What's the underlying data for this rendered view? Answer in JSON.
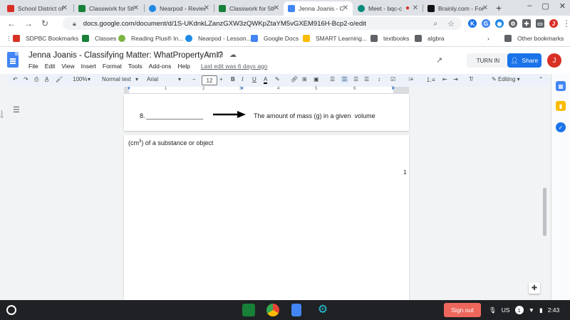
{
  "browser": {
    "tabs": [
      {
        "label": "School District of",
        "favicon_color": "#d93025"
      },
      {
        "label": "Classwork for 5th",
        "favicon_color": "#188038"
      },
      {
        "label": "Nearpod - Review",
        "favicon_color": "#1e88e5"
      },
      {
        "label": "Classwork for 5th",
        "favicon_color": "#188038"
      },
      {
        "label": "Jenna Joanis - Cl",
        "favicon_color": "#4285f4"
      },
      {
        "label": "Meet - bqc-c",
        "favicon_color": "#00897b"
      },
      {
        "label": "Brainly.com - For",
        "favicon_color": "#111111"
      }
    ],
    "active_tab_index": 4,
    "url": "docs.google.com/document/d/1S-UKdnkLZanzGXW3zQWKpZtaYM5vGXEM916H-Bcp2-o/edit",
    "bookmarks": [
      "SDPBC Bookmarks",
      "Classes",
      "Reading Plus® In...",
      "Nearpod - Lesson...",
      "Google Docs",
      "SMART Learning...",
      "textbooks",
      "algbra"
    ],
    "other_bookmarks": "Other bookmarks"
  },
  "doc": {
    "title": "Jenna Joanis - Classifying Matter: WhatPropertyAmI?",
    "menus": [
      "File",
      "Edit",
      "View",
      "Insert",
      "Format",
      "Tools",
      "Add-ons",
      "Help"
    ],
    "last_edit": "Last edit was 6 days ago",
    "turn_in": "TURN IN",
    "share": "Share",
    "account_initial": "J"
  },
  "toolbar": {
    "zoom": "100%",
    "style": "Normal text",
    "font": "Arial",
    "font_size": "12",
    "mode": "Editing"
  },
  "ruler": {
    "numbers": [
      "1",
      "1",
      "2",
      "3",
      "4",
      "5",
      "6",
      "7"
    ]
  },
  "content": {
    "q8_number": "8.",
    "q8_blank": "_________________",
    "q8_definition": "The amount of mass (g) in a given  volume",
    "p2_prefix": "(cm",
    "p2_superscript": "3",
    "p2_suffix": ") of a substance or object",
    "page_number": "1"
  },
  "shelf": {
    "sign_out": "Sign out",
    "locale": "US",
    "notification_count": "1",
    "time": "2:43"
  }
}
